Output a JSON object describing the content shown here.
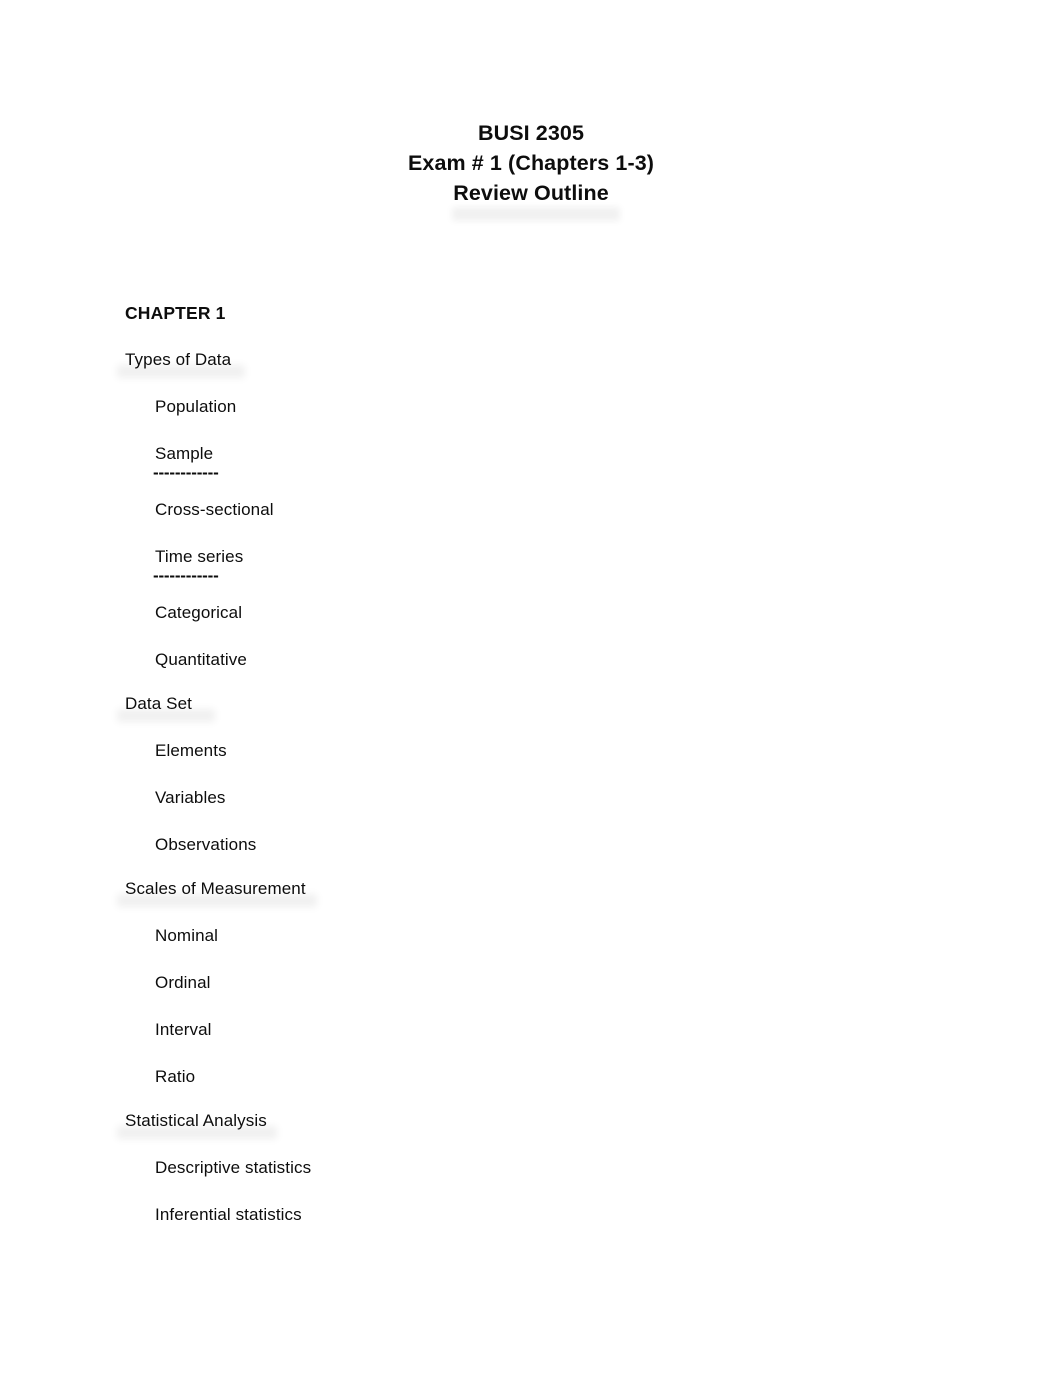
{
  "document": {
    "title_lines": [
      "BUSI 2305",
      "Exam # 1 (Chapters 1-3)",
      "Review Outline"
    ],
    "chapter_heading": "CHAPTER 1",
    "divider_text": "------------",
    "sections": [
      {
        "heading": "Types of Data",
        "items": [
          {
            "label": "Population"
          },
          {
            "label": "Sample"
          },
          {
            "label": "Cross-sectional"
          },
          {
            "label": "Time series"
          },
          {
            "label": "Categorical"
          },
          {
            "label": "Quantitative"
          }
        ]
      },
      {
        "heading": "Data Set",
        "items": [
          {
            "label": "Elements"
          },
          {
            "label": "Variables"
          },
          {
            "label": "Observations"
          }
        ]
      },
      {
        "heading": "Scales of Measurement",
        "items": [
          {
            "label": "Nominal"
          },
          {
            "label": "Ordinal"
          },
          {
            "label": "Interval"
          },
          {
            "label": "Ratio"
          }
        ]
      },
      {
        "heading": "Statistical Analysis",
        "items": [
          {
            "label": "Descriptive statistics"
          },
          {
            "label": "Inferential statistics"
          }
        ]
      }
    ]
  },
  "colors": {
    "page_background": "#ffffff",
    "text": "#0d0d0d"
  }
}
